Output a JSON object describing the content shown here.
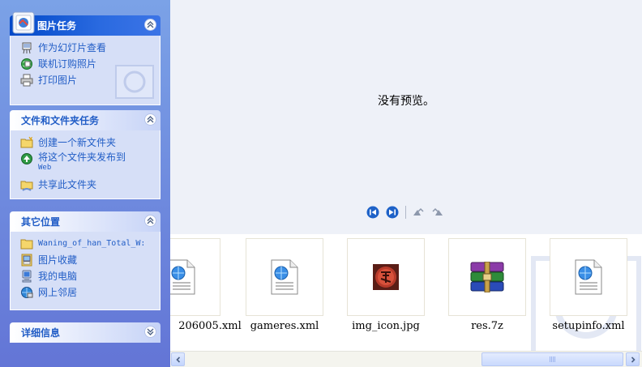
{
  "sidebar": {
    "picture_tasks": {
      "title": "图片任务",
      "items": [
        {
          "label": "作为幻灯片查看",
          "icon": "slideshow-icon"
        },
        {
          "label": "联机订购照片",
          "icon": "order-prints-icon"
        },
        {
          "label": "打印图片",
          "icon": "print-icon"
        }
      ]
    },
    "file_folder_tasks": {
      "title": "文件和文件夹任务",
      "items": [
        {
          "label": "创建一个新文件夹",
          "icon": "new-folder-icon"
        },
        {
          "label": "将这个文件夹发布到",
          "label_line2": "Web",
          "icon": "publish-web-icon"
        },
        {
          "label": "共享此文件夹",
          "icon": "share-folder-icon"
        }
      ]
    },
    "other_places": {
      "title": "其它位置",
      "items": [
        {
          "label": "Waning_of_han_Total_W:",
          "icon": "folder-icon"
        },
        {
          "label": "图片收藏",
          "icon": "my-pictures-icon"
        },
        {
          "label": "我的电脑",
          "icon": "my-computer-icon"
        },
        {
          "label": "网上邻居",
          "icon": "network-places-icon"
        }
      ]
    },
    "details": {
      "title": "详细信息"
    }
  },
  "preview": {
    "message": "没有预览。"
  },
  "filmstrip": {
    "items": [
      {
        "name": "206005.xml",
        "icon": "xml-file-icon"
      },
      {
        "name": "gameres.xml",
        "icon": "xml-file-icon"
      },
      {
        "name": "img_icon.jpg",
        "icon": "image-file-icon"
      },
      {
        "name": "res.7z",
        "icon": "winrar-archive-icon"
      },
      {
        "name": "setupinfo.xml",
        "icon": "xml-file-icon"
      }
    ]
  },
  "colors": {
    "sidebar_top": "#7ba2e7",
    "sidebar_bottom": "#6375d6",
    "link_blue": "#215dc6",
    "panel_body": "#d6dff7",
    "preview_bg": "#eef1f8"
  }
}
